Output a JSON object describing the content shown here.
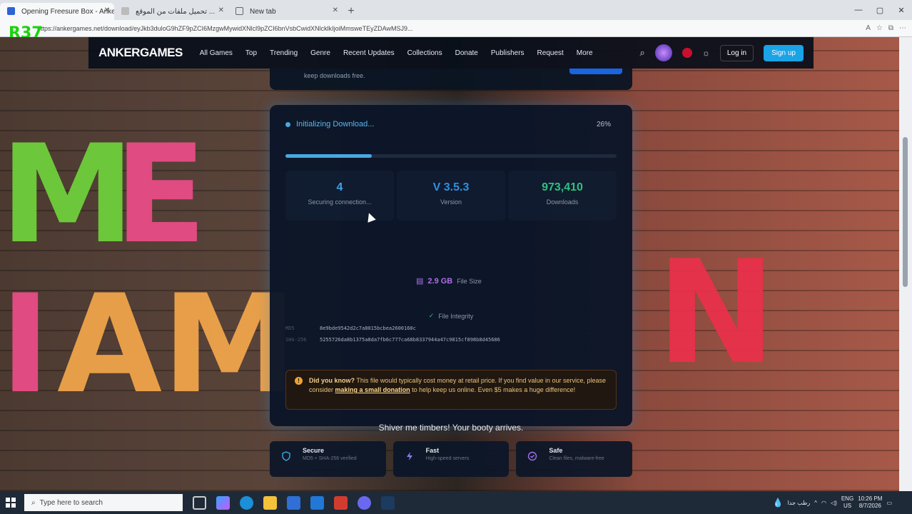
{
  "browser": {
    "tabs": [
      {
        "label": "Opening Freesure Box - AnkerGar...",
        "active": true
      },
      {
        "label": "تحميل ملفات من الموقع ...",
        "active": false
      },
      {
        "label": "New tab",
        "active": false
      }
    ],
    "url": "https://ankergames.net/download/eyJkb3duloG9hZF9pZCI6MzgwMywidXNlcl9pZCI6bnVsbCwidXNlcklkIjoiMmsweTEyZDAwMSJ9...",
    "badge": "R37"
  },
  "site": {
    "brand": "ANKERGAMES",
    "nav": [
      "All Games",
      "Top",
      "Trending",
      "Genre",
      "Recent Updates",
      "Collections",
      "Donate",
      "Publishers",
      "Request",
      "More"
    ],
    "login": "Log in",
    "signup": "Sign up",
    "top_card_text": "keep downloads free."
  },
  "download": {
    "status": "Initializing Download...",
    "percent": "26%",
    "progress_fraction": 0.26,
    "stats": [
      {
        "value": "4",
        "label": "Securing connection...",
        "color": "#3aa7e6"
      },
      {
        "value": "V 3.5.3",
        "label": "Version",
        "color": "#2f8fe0"
      },
      {
        "value": "973,410",
        "label": "Downloads",
        "color": "#2ec27e"
      }
    ],
    "file_size": "2.9 GB",
    "file_size_label": "File Size",
    "integrity_title": "File Integrity",
    "hashes": [
      {
        "key": "MD5",
        "value": "8e9bde9542d2c7a8015bcbea2600160c"
      },
      {
        "key": "SHA-256",
        "value": "5255726da8b1375a8da7fb6c777ca68b8337944a47c9815cf898b8d45686"
      }
    ],
    "notice_bold": "Did you know?",
    "notice_text": "This file would typically cost money at retail price. If you find value in our service, please consider",
    "notice_link": "making a small donation",
    "notice_tail": "to help keep us online. Even $5 makes a huge difference!",
    "tagline": "Shiver me timbers! Your booty arrives."
  },
  "features": [
    {
      "title": "Secure",
      "sub": "MD5 + SHA-256 verified",
      "icon": "shield-icon",
      "color": "#3aa7e6"
    },
    {
      "title": "Fast",
      "sub": "High-speed servers",
      "icon": "lightning-icon",
      "color": "#8b7bff"
    },
    {
      "title": "Safe",
      "sub": "Clean files, malware-free",
      "icon": "check-circle-icon",
      "color": "#a06ef0"
    }
  ],
  "taskbar": {
    "search_placeholder": "Type here to search",
    "weather": "رطب جدا",
    "lang": "ENG",
    "region": "US",
    "time": "10:26 PM",
    "date": "8/7/2026"
  }
}
